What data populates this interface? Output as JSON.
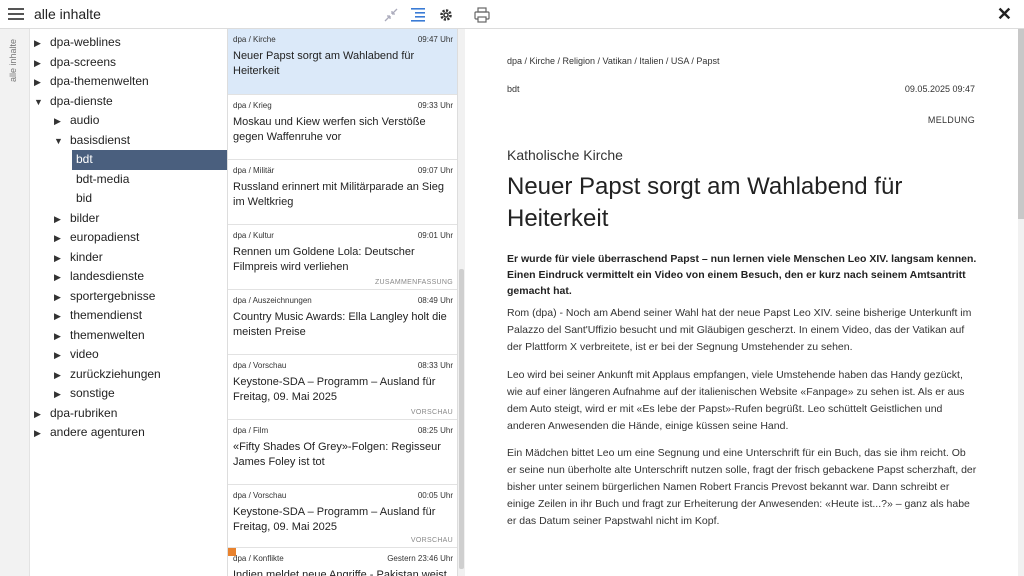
{
  "topbar": {
    "title": "alle inhalte",
    "close_label": "✕"
  },
  "siderail": {
    "label": "alle inhalte"
  },
  "tree": [
    {
      "label": "dpa-weblines",
      "arrow": "▶",
      "level": 0
    },
    {
      "label": "dpa-screens",
      "arrow": "▶",
      "level": 0
    },
    {
      "label": "dpa-themenwelten",
      "arrow": "▶",
      "level": 0
    },
    {
      "label": "dpa-dienste",
      "arrow": "▼",
      "level": 0
    },
    {
      "label": "audio",
      "arrow": "▶",
      "level": 1
    },
    {
      "label": "basisdienst",
      "arrow": "▼",
      "level": 1
    },
    {
      "label": "bdt",
      "arrow": "",
      "level": 2,
      "selected": true
    },
    {
      "label": "bdt-media",
      "arrow": "",
      "level": 2
    },
    {
      "label": "bid",
      "arrow": "",
      "level": 2
    },
    {
      "label": "bilder",
      "arrow": "▶",
      "level": 1
    },
    {
      "label": "europadienst",
      "arrow": "▶",
      "level": 1
    },
    {
      "label": "kinder",
      "arrow": "▶",
      "level": 1
    },
    {
      "label": "landesdienste",
      "arrow": "▶",
      "level": 1
    },
    {
      "label": "sportergebnisse",
      "arrow": "▶",
      "level": 1
    },
    {
      "label": "themendienst",
      "arrow": "▶",
      "level": 1
    },
    {
      "label": "themenwelten",
      "arrow": "▶",
      "level": 1
    },
    {
      "label": "video",
      "arrow": "▶",
      "level": 1
    },
    {
      "label": "zurückziehungen",
      "arrow": "▶",
      "level": 1
    },
    {
      "label": "sonstige",
      "arrow": "▶",
      "level": 1
    },
    {
      "label": "dpa-rubriken",
      "arrow": "▶",
      "level": 0
    },
    {
      "label": "andere agenturen",
      "arrow": "▶",
      "level": 0
    }
  ],
  "list": [
    {
      "meta": "dpa / Kirche",
      "time": "09:47 Uhr",
      "title": "Neuer Papst sorgt am Wahlabend für Heiterkeit",
      "tag": "",
      "selected": true
    },
    {
      "meta": "dpa / Krieg",
      "time": "09:33 Uhr",
      "title": "Moskau und Kiew werfen sich Verstöße gegen Waffenruhe vor",
      "tag": ""
    },
    {
      "meta": "dpa / Militär",
      "time": "09:07 Uhr",
      "title": "Russland erinnert mit Militärparade an Sieg im Weltkrieg",
      "tag": ""
    },
    {
      "meta": "dpa / Kultur",
      "time": "09:01 Uhr",
      "title": "Rennen um Goldene Lola: Deutscher Filmpreis wird verliehen",
      "tag": "ZUSAMMENFASSUNG"
    },
    {
      "meta": "dpa / Auszeichnungen",
      "time": "08:49 Uhr",
      "title": "Country Music Awards: Ella Langley holt die meisten Preise",
      "tag": ""
    },
    {
      "meta": "dpa / Vorschau",
      "time": "08:33 Uhr",
      "title": "Keystone-SDA – Programm – Ausland für Freitag, 09. Mai 2025",
      "tag": "VORSCHAU"
    },
    {
      "meta": "dpa / Film",
      "time": "08:25 Uhr",
      "title": "«Fifty Shades Of Grey»-Folgen: Regisseur James Foley ist tot",
      "tag": ""
    },
    {
      "meta": "dpa / Vorschau",
      "time": "00:05 Uhr",
      "title": "Keystone-SDA – Programm – Ausland für Freitag, 09. Mai 2025",
      "tag": "VORSCHAU"
    },
    {
      "meta": "dpa / Konflikte",
      "time": "Gestern 23:46 Uhr",
      "title": "Indien meldet neue Angriffe - Pakistan weist",
      "tag": "",
      "flag": true
    }
  ],
  "article": {
    "breadcrumb": "dpa / Kirche / Religion / Vatikan / Italien / USA / Papst",
    "source": "bdt",
    "date": "09.05.2025 09:47",
    "type": "MELDUNG",
    "kicker": "Katholische Kirche",
    "headline": "Neuer Papst sorgt am Wahlabend für Heiterkeit",
    "lead": "Er wurde für viele überraschend Papst – nun lernen viele Menschen Leo XIV. langsam kennen. Einen Eindruck vermittelt ein Video von einem Besuch, den er kurz nach seinem Amtsantritt gemacht hat.",
    "paragraphs": [
      "Rom (dpa) - Noch am Abend seiner Wahl hat der neue Papst Leo XIV. seine bisherige Unterkunft im Palazzo del Sant'Uffizio besucht und mit Gläubigen gescherzt. In einem Video, das der Vatikan auf der Plattform X verbreitete, ist er bei der Segnung Umstehender zu sehen.",
      "Leo wird bei seiner Ankunft mit Applaus empfangen, viele Umstehende haben das Handy gezückt, wie auf einer längeren Aufnahme auf der italienischen Website «Fanpage» zu sehen ist. Als er aus dem Auto steigt, wird er mit «Es lebe der Papst»-Rufen begrüßt. Leo schüttelt Geistlichen und anderen Anwesenden die Hände, einige küssen seine Hand.",
      "Ein Mädchen bittet Leo um eine Segnung und eine Unterschrift für ein Buch, das sie ihm reicht. Ob er seine nun überholte alte Unterschrift nutzen solle, fragt der frisch gebackene Papst scherzhaft, der bisher unter seinem bürgerlichen Namen Robert Francis Prevost bekannt war. Dann schreibt er einige Zeilen in ihr Buch und fragt zur Erheiterung der Anwesenden: «Heute ist...?» – ganz als habe er das Datum seiner Papstwahl nicht im Kopf."
    ]
  }
}
